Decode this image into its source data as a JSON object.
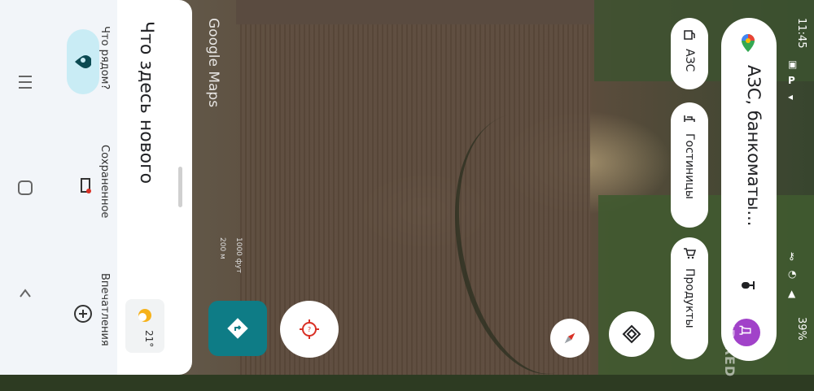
{
  "watermark": "Google Maps",
  "scale": {
    "metric": "200 м",
    "imperial": "1000 фут"
  },
  "sheet": {
    "title": "Что здесь нового",
    "weather_temp": "21°"
  },
  "bottom_nav": [
    {
      "label": "Что рядом?",
      "icon": "location-pin-icon"
    },
    {
      "label": "Сохраненное",
      "icon": "bookmark-icon"
    },
    {
      "label": "Впечатления",
      "icon": "add-circle-icon"
    }
  ],
  "search": {
    "placeholder": "АЗС, банкоматы..."
  },
  "chips": [
    {
      "label": "АЗС",
      "icon": "gas-station-icon"
    },
    {
      "label": "Гостиницы",
      "icon": "hotel-icon"
    },
    {
      "label": "Продукты",
      "icon": "shopping-cart-icon"
    }
  ],
  "status": {
    "time": "11:45",
    "battery": "39%"
  },
  "avatar_letter": "Д",
  "watermark_dnr": "DNR RED",
  "colors": {
    "accent": "#0e7c86",
    "search_bg": "#ffffff",
    "avatar": "#a142c9"
  }
}
